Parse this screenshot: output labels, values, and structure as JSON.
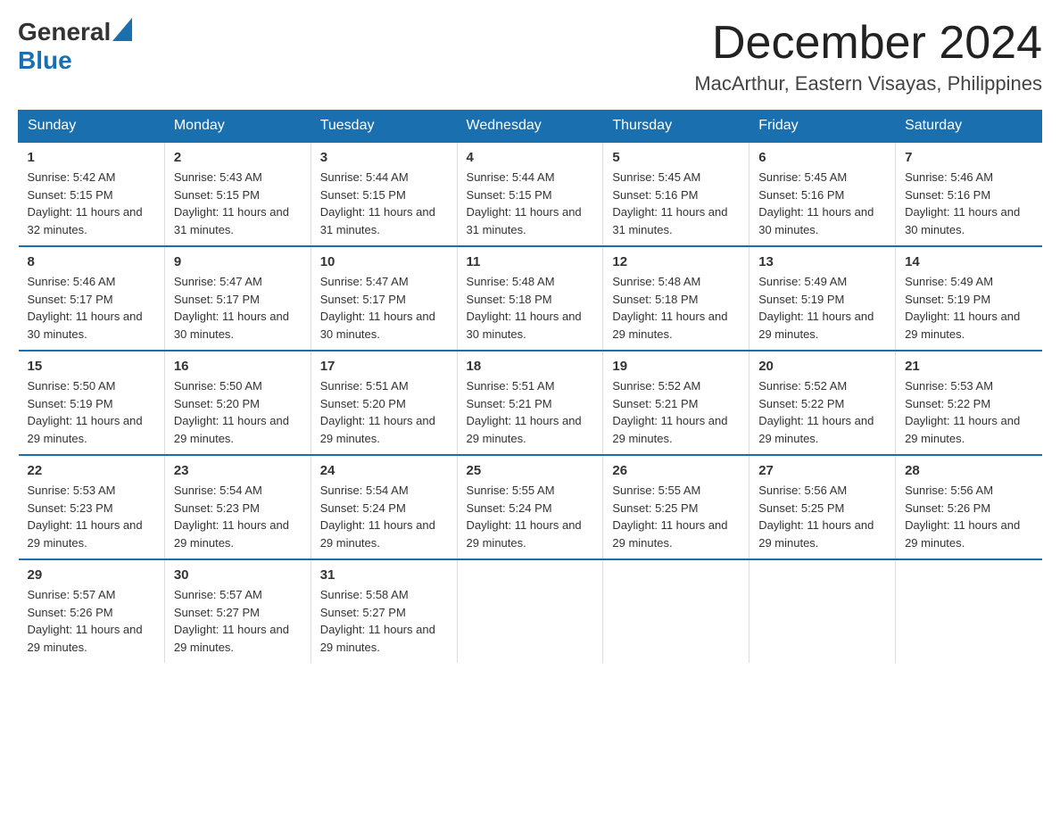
{
  "logo": {
    "general": "General",
    "blue": "Blue"
  },
  "title": "December 2024",
  "location": "MacArthur, Eastern Visayas, Philippines",
  "days_of_week": [
    "Sunday",
    "Monday",
    "Tuesday",
    "Wednesday",
    "Thursday",
    "Friday",
    "Saturday"
  ],
  "weeks": [
    [
      {
        "day": "1",
        "sunrise": "5:42 AM",
        "sunset": "5:15 PM",
        "daylight": "11 hours and 32 minutes."
      },
      {
        "day": "2",
        "sunrise": "5:43 AM",
        "sunset": "5:15 PM",
        "daylight": "11 hours and 31 minutes."
      },
      {
        "day": "3",
        "sunrise": "5:44 AM",
        "sunset": "5:15 PM",
        "daylight": "11 hours and 31 minutes."
      },
      {
        "day": "4",
        "sunrise": "5:44 AM",
        "sunset": "5:15 PM",
        "daylight": "11 hours and 31 minutes."
      },
      {
        "day": "5",
        "sunrise": "5:45 AM",
        "sunset": "5:16 PM",
        "daylight": "11 hours and 31 minutes."
      },
      {
        "day": "6",
        "sunrise": "5:45 AM",
        "sunset": "5:16 PM",
        "daylight": "11 hours and 30 minutes."
      },
      {
        "day": "7",
        "sunrise": "5:46 AM",
        "sunset": "5:16 PM",
        "daylight": "11 hours and 30 minutes."
      }
    ],
    [
      {
        "day": "8",
        "sunrise": "5:46 AM",
        "sunset": "5:17 PM",
        "daylight": "11 hours and 30 minutes."
      },
      {
        "day": "9",
        "sunrise": "5:47 AM",
        "sunset": "5:17 PM",
        "daylight": "11 hours and 30 minutes."
      },
      {
        "day": "10",
        "sunrise": "5:47 AM",
        "sunset": "5:17 PM",
        "daylight": "11 hours and 30 minutes."
      },
      {
        "day": "11",
        "sunrise": "5:48 AM",
        "sunset": "5:18 PM",
        "daylight": "11 hours and 30 minutes."
      },
      {
        "day": "12",
        "sunrise": "5:48 AM",
        "sunset": "5:18 PM",
        "daylight": "11 hours and 29 minutes."
      },
      {
        "day": "13",
        "sunrise": "5:49 AM",
        "sunset": "5:19 PM",
        "daylight": "11 hours and 29 minutes."
      },
      {
        "day": "14",
        "sunrise": "5:49 AM",
        "sunset": "5:19 PM",
        "daylight": "11 hours and 29 minutes."
      }
    ],
    [
      {
        "day": "15",
        "sunrise": "5:50 AM",
        "sunset": "5:19 PM",
        "daylight": "11 hours and 29 minutes."
      },
      {
        "day": "16",
        "sunrise": "5:50 AM",
        "sunset": "5:20 PM",
        "daylight": "11 hours and 29 minutes."
      },
      {
        "day": "17",
        "sunrise": "5:51 AM",
        "sunset": "5:20 PM",
        "daylight": "11 hours and 29 minutes."
      },
      {
        "day": "18",
        "sunrise": "5:51 AM",
        "sunset": "5:21 PM",
        "daylight": "11 hours and 29 minutes."
      },
      {
        "day": "19",
        "sunrise": "5:52 AM",
        "sunset": "5:21 PM",
        "daylight": "11 hours and 29 minutes."
      },
      {
        "day": "20",
        "sunrise": "5:52 AM",
        "sunset": "5:22 PM",
        "daylight": "11 hours and 29 minutes."
      },
      {
        "day": "21",
        "sunrise": "5:53 AM",
        "sunset": "5:22 PM",
        "daylight": "11 hours and 29 minutes."
      }
    ],
    [
      {
        "day": "22",
        "sunrise": "5:53 AM",
        "sunset": "5:23 PM",
        "daylight": "11 hours and 29 minutes."
      },
      {
        "day": "23",
        "sunrise": "5:54 AM",
        "sunset": "5:23 PM",
        "daylight": "11 hours and 29 minutes."
      },
      {
        "day": "24",
        "sunrise": "5:54 AM",
        "sunset": "5:24 PM",
        "daylight": "11 hours and 29 minutes."
      },
      {
        "day": "25",
        "sunrise": "5:55 AM",
        "sunset": "5:24 PM",
        "daylight": "11 hours and 29 minutes."
      },
      {
        "day": "26",
        "sunrise": "5:55 AM",
        "sunset": "5:25 PM",
        "daylight": "11 hours and 29 minutes."
      },
      {
        "day": "27",
        "sunrise": "5:56 AM",
        "sunset": "5:25 PM",
        "daylight": "11 hours and 29 minutes."
      },
      {
        "day": "28",
        "sunrise": "5:56 AM",
        "sunset": "5:26 PM",
        "daylight": "11 hours and 29 minutes."
      }
    ],
    [
      {
        "day": "29",
        "sunrise": "5:57 AM",
        "sunset": "5:26 PM",
        "daylight": "11 hours and 29 minutes."
      },
      {
        "day": "30",
        "sunrise": "5:57 AM",
        "sunset": "5:27 PM",
        "daylight": "11 hours and 29 minutes."
      },
      {
        "day": "31",
        "sunrise": "5:58 AM",
        "sunset": "5:27 PM",
        "daylight": "11 hours and 29 minutes."
      },
      null,
      null,
      null,
      null
    ]
  ],
  "labels": {
    "sunrise_prefix": "Sunrise: ",
    "sunset_prefix": "Sunset: ",
    "daylight_prefix": "Daylight: "
  }
}
